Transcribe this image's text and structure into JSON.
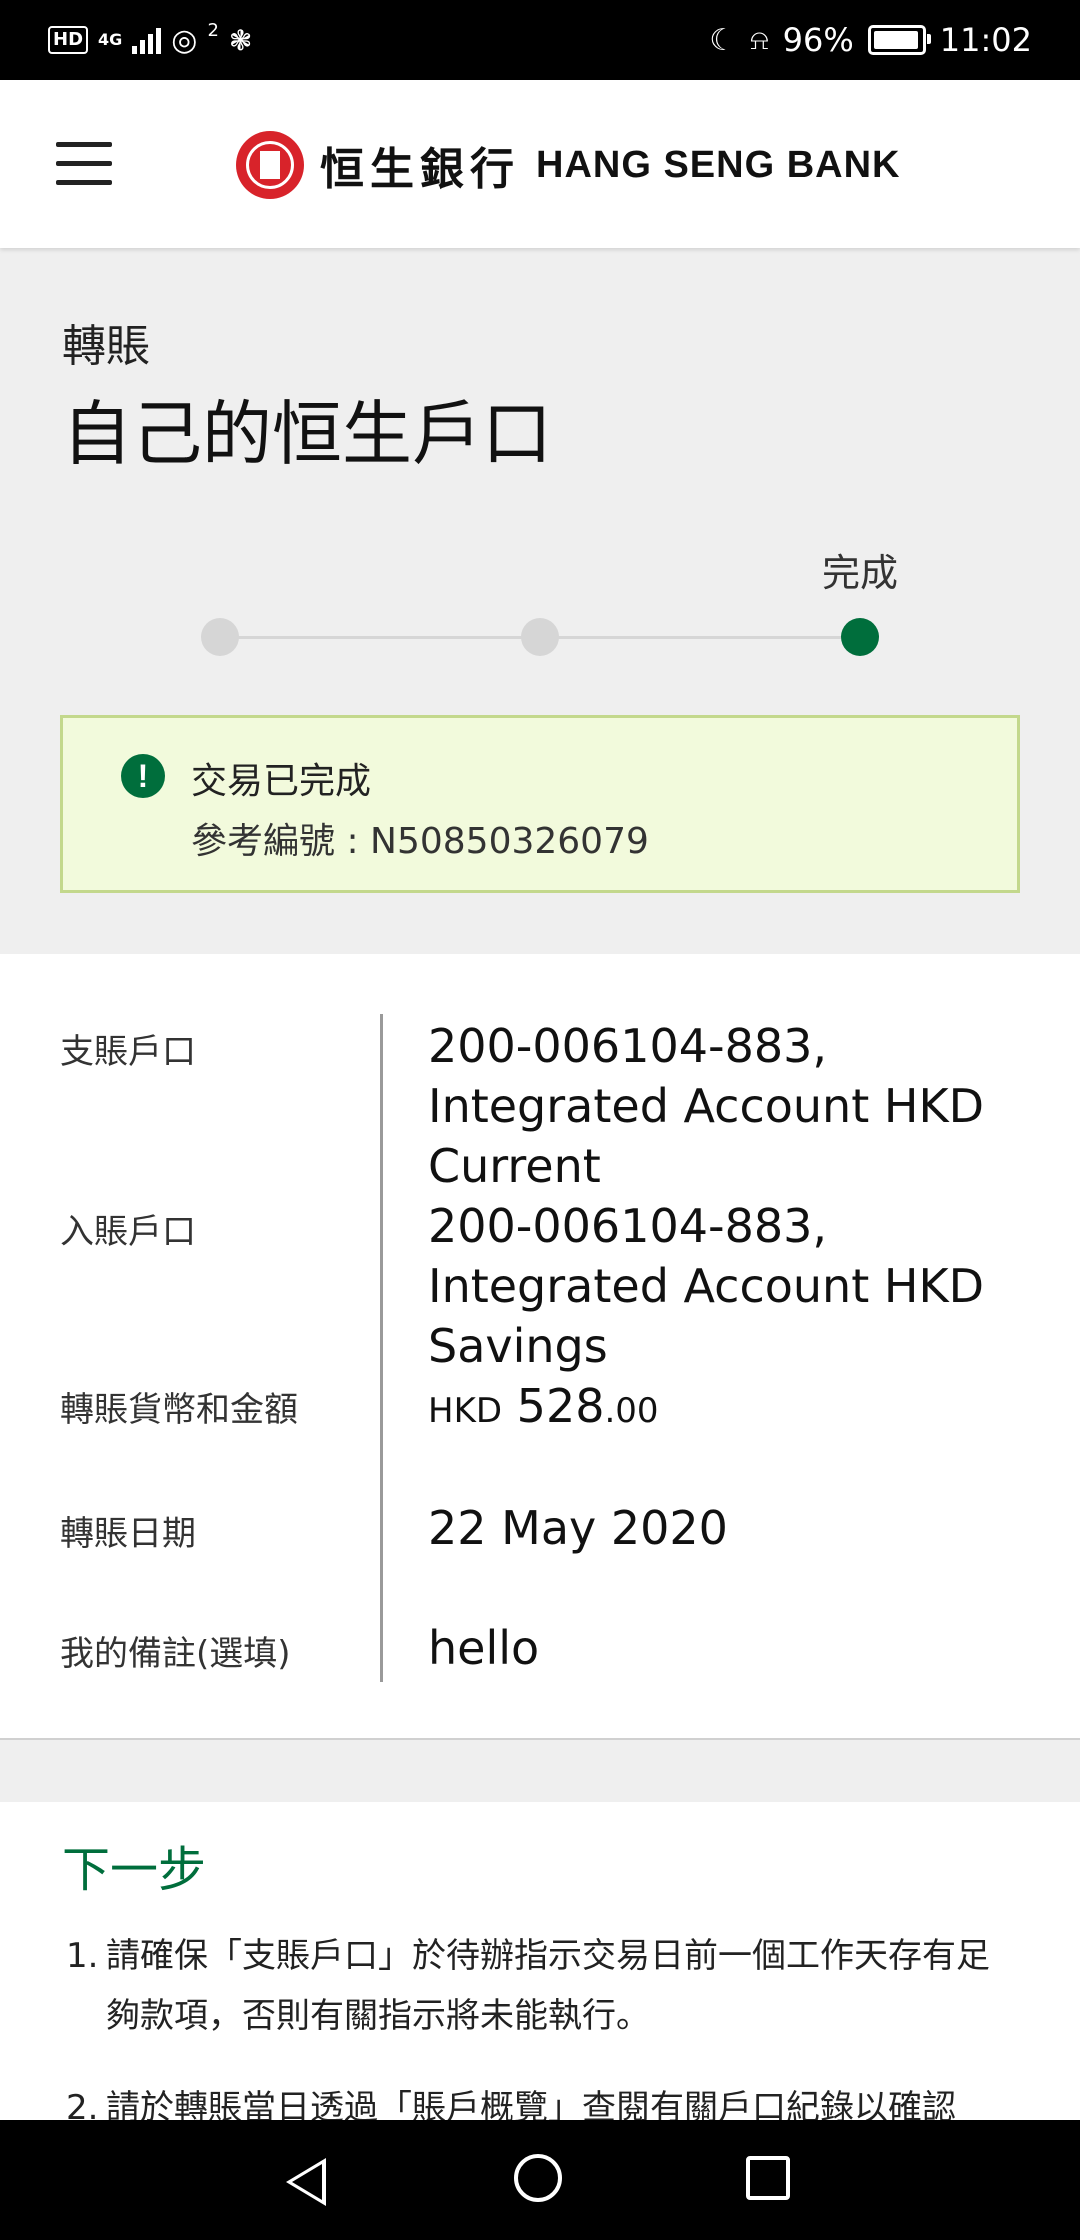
{
  "status_bar": {
    "hd": "HD",
    "network": "4G",
    "hotspot_count": "2",
    "battery": "96%",
    "time": "11:02",
    "battery_level": 0.96
  },
  "header": {
    "logo_cn": "恒生銀行",
    "logo_en": "HANG SENG BANK",
    "brand_color": "#d8232a"
  },
  "page": {
    "breadcrumb": "轉賬",
    "title": "自己的恒生戶口",
    "current_step_label": "完成",
    "steps_total": 3,
    "current_step": 3
  },
  "alert": {
    "icon": "exclamation-circle-icon",
    "title": "交易已完成",
    "reference": "參考編號 : N50850326079"
  },
  "details": {
    "from_label": "支賬戶口",
    "from_value": "200-006104-883, Integrated Account HKD Current",
    "to_label": "入賬戶口",
    "to_value": "200-006104-883, Integrated Account HKD Savings",
    "amount_label": "轉賬貨幣和金額",
    "amount_currency": "HKD",
    "amount_integer": "528",
    "amount_decimal": ".00",
    "date_label": "轉賬日期",
    "date_value": "22 May 2020",
    "remark_label": "我的備註(選填)",
    "remark_value": "hello"
  },
  "next_steps": {
    "title": "下一步",
    "items": [
      {
        "num": "1.",
        "text": "請確保「支賬戶口」於待辦指示交易日前一個工作天存有足夠款項，否則有關指示將未能執行。"
      },
      {
        "num": "2.",
        "text": "請於轉賬當日透過「賬戶概覽」查閱有關戶口紀錄以確認"
      }
    ]
  },
  "colors": {
    "accent_green": "#006e3c",
    "alert_bg": "#f2fadc",
    "alert_border": "#c3d88c"
  }
}
